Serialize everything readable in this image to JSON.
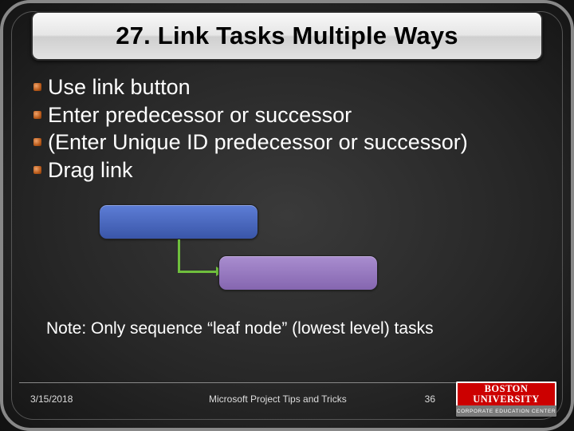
{
  "title": "27. Link Tasks Multiple Ways",
  "bullets": [
    "Use link button",
    "Enter predecessor or successor",
    "(Enter Unique ID predecessor or successor)",
    "Drag link"
  ],
  "note": "Note: Only sequence “leaf node” (lowest level) tasks",
  "footer": {
    "date": "3/15/2018",
    "topic": "Microsoft Project Tips and Tricks",
    "page": "36"
  },
  "logo": {
    "org_line1": "BOSTON",
    "org_line2": "UNIVERSITY",
    "tagline": "CORPORATE EDUCATION CENTER"
  },
  "colors": {
    "task1": "#4a66b8",
    "task2": "#8f72bb",
    "link": "#6fbf3d"
  }
}
